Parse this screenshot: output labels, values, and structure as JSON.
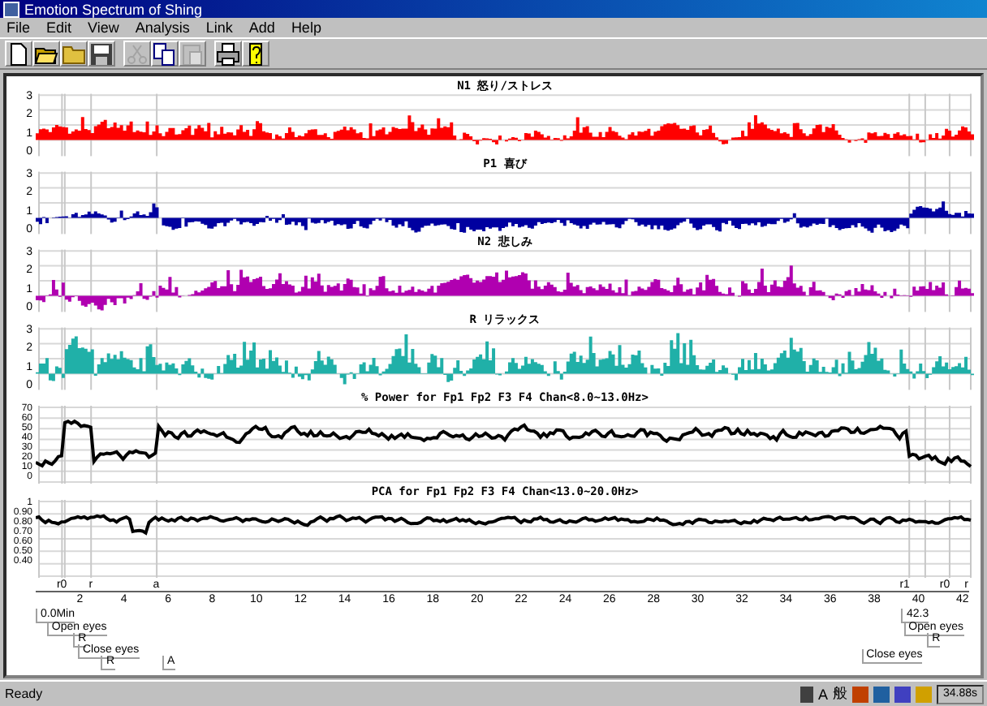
{
  "window": {
    "title": "Emotion Spectrum of Shing"
  },
  "menu": [
    "File",
    "Edit",
    "View",
    "Analysis",
    "Link",
    "Add",
    "Help"
  ],
  "toolbar": [
    {
      "kind": "new",
      "disabled": false
    },
    {
      "kind": "open",
      "disabled": false
    },
    {
      "kind": "folder",
      "disabled": false
    },
    {
      "kind": "save",
      "disabled": false
    },
    {
      "kind": "cut",
      "disabled": true
    },
    {
      "kind": "copy",
      "disabled": false
    },
    {
      "kind": "paste",
      "disabled": true
    },
    {
      "kind": "print",
      "disabled": false
    },
    {
      "kind": "help",
      "disabled": false
    }
  ],
  "panels": [
    {
      "title": "N1 怒り/ストレス",
      "kind": "bars",
      "color": "#ff0000",
      "yticks": [
        "3",
        "2",
        "1",
        "0"
      ]
    },
    {
      "title": "P1 喜び",
      "kind": "bars",
      "color": "#0000a0",
      "yticks": [
        "3",
        "2",
        "1",
        "0"
      ]
    },
    {
      "title": "N2 悲しみ",
      "kind": "bars",
      "color": "#b000b0",
      "yticks": [
        "3",
        "2",
        "1",
        "0"
      ]
    },
    {
      "title": "R リラックス",
      "kind": "bars",
      "color": "#20b0a8",
      "yticks": [
        "3",
        "2",
        "1",
        "0"
      ]
    },
    {
      "title": "% Power for Fp1 Fp2 F3 F4 Chan<8.0~13.0Hz>",
      "kind": "line",
      "color": "#000000",
      "yticks": [
        "70",
        "60",
        "50",
        "40",
        "30",
        "20",
        "10",
        "0"
      ]
    },
    {
      "title": "PCA for Fp1 Fp2 F3 F4 Chan<13.0~20.0Hz>",
      "kind": "line",
      "color": "#000000",
      "yticks": [
        "1",
        "0.90",
        "0.80",
        "0.70",
        "0.60",
        "0.50",
        "0.40"
      ]
    }
  ],
  "markers": [
    "r0",
    "r",
    "a",
    "r1",
    "r0",
    "r"
  ],
  "xticks": [
    "2",
    "4",
    "6",
    "8",
    "10",
    "12",
    "14",
    "16",
    "18",
    "20",
    "22",
    "24",
    "26",
    "28",
    "30",
    "32",
    "34",
    "36",
    "38",
    "40",
    "42"
  ],
  "annotations": [
    "0.0Min",
    "Open eyes",
    "R",
    "Close eyes",
    "R",
    "A",
    "42.3",
    "Open eyes",
    "R",
    "Close eyes"
  ],
  "status_bar": {
    "text": "Ready",
    "ime": [
      "A",
      "般"
    ],
    "clock": "34.88s"
  }
}
